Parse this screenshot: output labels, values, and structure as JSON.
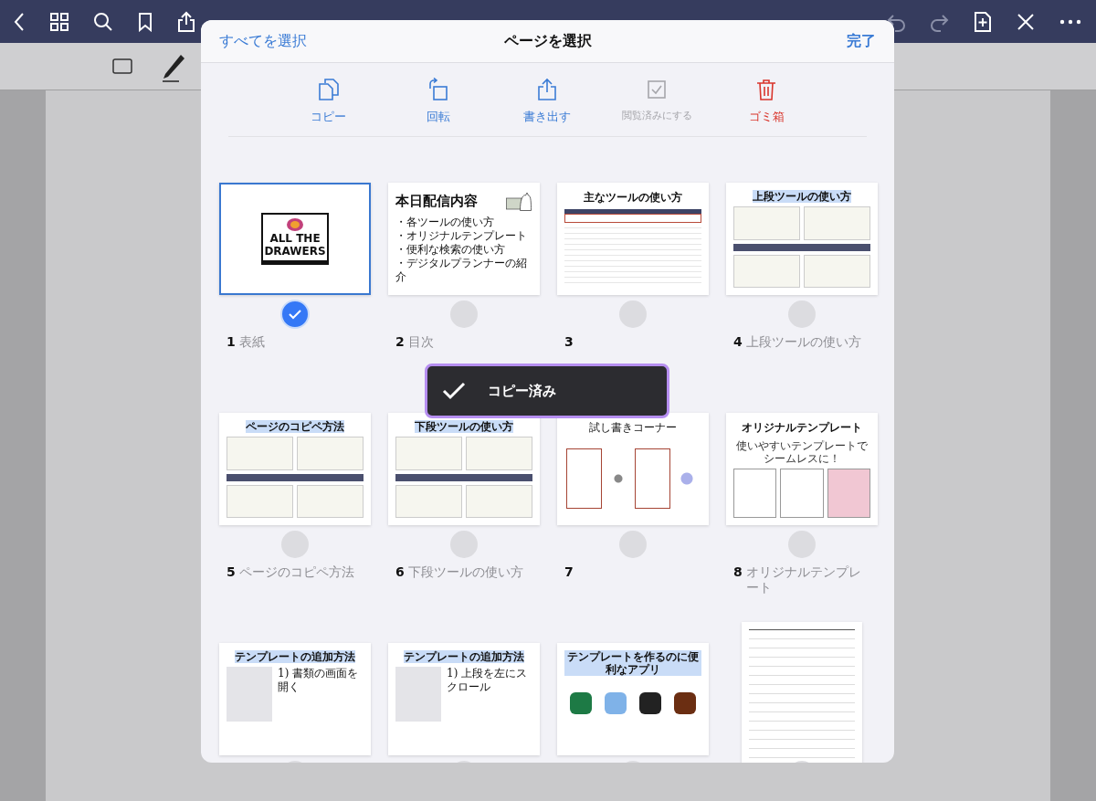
{
  "sheet": {
    "select_all": "すべてを選択",
    "title": "ページを選択",
    "done": "完了"
  },
  "actions": [
    {
      "kind": "copy",
      "label": "コピー",
      "disabled": false
    },
    {
      "kind": "rotate",
      "label": "回転",
      "disabled": false
    },
    {
      "kind": "export",
      "label": "書き出す",
      "disabled": false
    },
    {
      "kind": "mark-read",
      "label": "閲覧済みにする",
      "disabled": true
    },
    {
      "kind": "trash",
      "label": "ゴミ箱",
      "disabled": false
    }
  ],
  "pages": [
    {
      "number": "1",
      "label": "表紙",
      "selected": true,
      "kind": "logo",
      "title": "ALL THE DRAWERS"
    },
    {
      "number": "2",
      "label": "目次",
      "selected": false,
      "kind": "list",
      "title": "本日配信内容",
      "lines": [
        "・各ツールの使い方",
        "・オリジナルテンプレート",
        "・便利な検索の使い方",
        "・デジタルプランナーの紹介"
      ]
    },
    {
      "number": "3",
      "selected": false,
      "kind": "screenshot",
      "title": "主なツールの使い方"
    },
    {
      "number": "4",
      "label": "上段ツールの使い方",
      "selected": false,
      "kind": "diagram",
      "title": "上段ツールの使い方"
    },
    {
      "number": "5",
      "label": "ページのコピペ方法",
      "selected": false,
      "kind": "diagram",
      "title": "ページのコピペ方法"
    },
    {
      "number": "6",
      "label": "下段ツールの使い方",
      "selected": false,
      "kind": "diagram",
      "title": "下段ツールの使い方"
    },
    {
      "number": "7",
      "selected": false,
      "kind": "practice",
      "title": "試し書きコーナー"
    },
    {
      "number": "8",
      "label": "オリジナルテンプレート",
      "selected": false,
      "kind": "poster",
      "title": "オリジナルテンプレート",
      "lines": [
        "使いやすいテンプレートでシームレスに！"
      ]
    },
    {
      "selected": false,
      "kind": "steps",
      "title": "テンプレートの追加方法",
      "lines": [
        "1) 書類の画面を開く"
      ]
    },
    {
      "selected": false,
      "kind": "steps",
      "title": "テンプレートの追加方法",
      "lines": [
        "1) 上段を左にスクロール"
      ]
    },
    {
      "selected": false,
      "kind": "apps",
      "title": "テンプレートを作るのに便利なアプリ"
    },
    {
      "selected": false,
      "kind": "form"
    }
  ],
  "toast": {
    "text": "コピー済み"
  }
}
